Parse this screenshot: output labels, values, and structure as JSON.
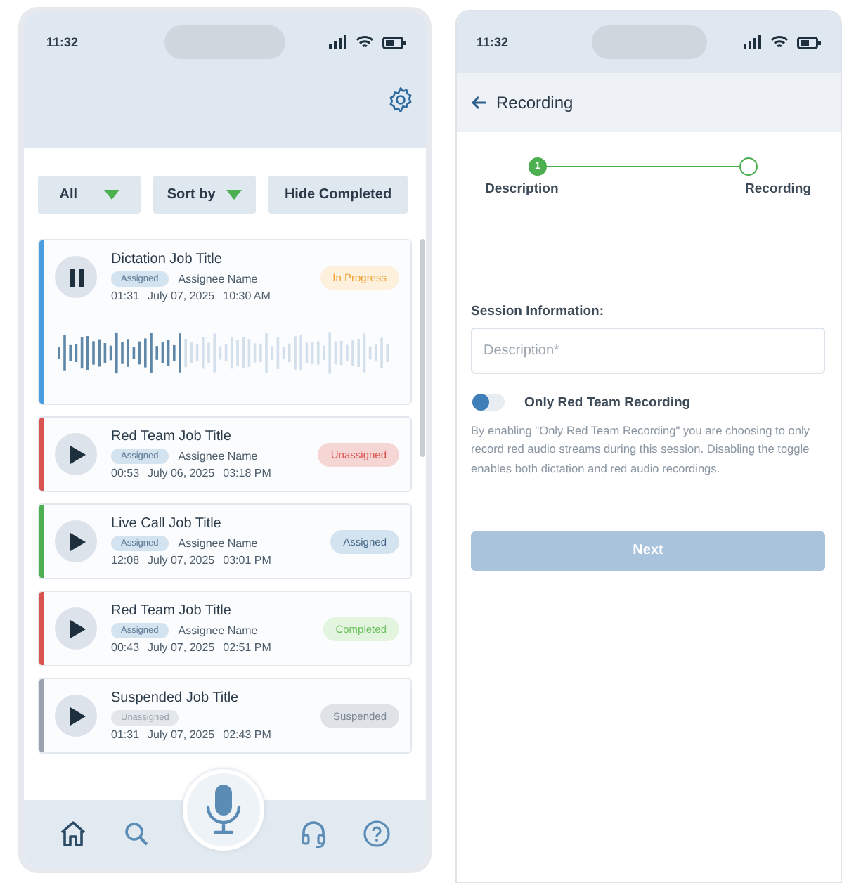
{
  "list_screen": {
    "time": "11:32",
    "filters": [
      {
        "label": "All",
        "kind": "dropdown"
      },
      {
        "label": "Sort by",
        "kind": "dropdown"
      },
      {
        "label": "Hide Completed",
        "kind": "button"
      }
    ],
    "jobs": [
      {
        "title": "Dictation Job Title",
        "tag": {
          "text": "Assigned",
          "kind": "assigned"
        },
        "assignee": "Assignee Name",
        "duration": "01:31",
        "date": "July 07, 2025",
        "time": "10:30 AM",
        "status": {
          "text": "In Progress",
          "kind": "progress"
        },
        "color": "#4a9ee0",
        "playing": true
      },
      {
        "title": "Red Team Job Title",
        "tag": {
          "text": "Assigned",
          "kind": "assigned"
        },
        "assignee": "Assignee Name",
        "duration": "00:53",
        "date": "July 06, 2025",
        "time": "03:18 PM",
        "status": {
          "text": "Unassigned",
          "kind": "unassigned"
        },
        "color": "#d9534f",
        "playing": false
      },
      {
        "title": "Live Call Job Title",
        "tag": {
          "text": "Assigned",
          "kind": "assigned"
        },
        "assignee": "Assignee Name",
        "duration": "12:08",
        "date": "July 07, 2025",
        "time": "03:01 PM",
        "status": {
          "text": "Assigned",
          "kind": "assigned"
        },
        "color": "#4caf50",
        "playing": false
      },
      {
        "title": "Red Team Job Title",
        "tag": {
          "text": "Assigned",
          "kind": "assigned"
        },
        "assignee": "Assignee Name",
        "duration": "00:43",
        "date": "July 07, 2025",
        "time": "02:51 PM",
        "status": {
          "text": "Completed",
          "kind": "completed"
        },
        "color": "#d9534f",
        "playing": false
      },
      {
        "title": "Suspended Job Title",
        "tag": {
          "text": "Unassigned",
          "kind": "unassigned"
        },
        "duration": "01:31",
        "date": "July 07, 2025",
        "time": "02:43 PM",
        "status": {
          "text": "Suspended",
          "kind": "suspended"
        },
        "color": "#9aa3ae",
        "playing": false
      }
    ],
    "nav": [
      {
        "kind": "home"
      },
      {
        "kind": "search"
      },
      {
        "kind": "mic"
      },
      {
        "kind": "headset"
      },
      {
        "kind": "help"
      }
    ]
  },
  "recording_screen": {
    "time": "11:32",
    "title": "Recording",
    "steps": [
      {
        "label": "Description",
        "number": "1",
        "done": true
      },
      {
        "label": "Recording",
        "done": false
      }
    ],
    "section_label": "Session Information:",
    "field": {
      "placeholder": "Description*"
    },
    "toggle": {
      "label": "Only Red Team Recording",
      "on": false
    },
    "note": "By enabling \"Only Red Team Recording\" you are choosing to only record red audio streams during this session. Disabling the toggle enables both dictation and red audio recordings.",
    "next_button": {
      "label": "Next",
      "disabled": true
    }
  }
}
